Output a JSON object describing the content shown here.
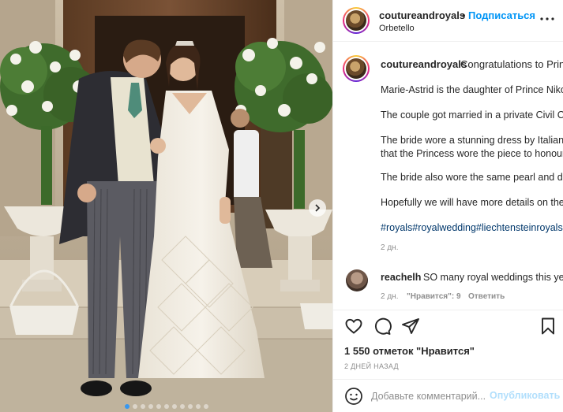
{
  "photo": {
    "alt_name": "wedding-photo",
    "slide_count": 11,
    "active_slide": 1
  },
  "header": {
    "username": "coutureandroyals",
    "separator": "•",
    "follow_label": "Подписаться",
    "location": "Orbetello",
    "more_icon": "more-horizontal-icon"
  },
  "caption": {
    "username": "coutureandroyals",
    "text": "Congratulations to Princ",
    "paragraphs": [
      "Marie-Astrid is the daughter of Prince Niko",
      "The couple got married in a private Civil Ce",
      "The bride wore a stunning dress by Italian c",
      "that the Princess wore the piece to honour",
      "The bride also wore the same pearl and dia",
      "Hopefully we will have more details on the"
    ],
    "hashtags": "#royals#royalwedding#liechtensteinroyals#",
    "age": "2 дн."
  },
  "comment": {
    "username": "reachelh",
    "text": "SO many royal weddings this yea",
    "age": "2 дн.",
    "likes": "\"Нравится\": 9",
    "reply": "Ответить"
  },
  "actions": {
    "like_icon": "heart-icon",
    "comment_icon": "comment-icon",
    "share_icon": "share-icon",
    "save_icon": "bookmark-icon"
  },
  "stats": {
    "likes": "1 550 отметок \"Нравится\"",
    "date": "2 ДНЕЙ НАЗАД"
  },
  "composer": {
    "placeholder": "Добавьте комментарий...",
    "publish_label": "Опубликовать",
    "emoji_icon": "emoji-icon"
  },
  "colors": {
    "accent": "#0095f6",
    "hashtag": "#00376b",
    "muted": "#8e8e8e",
    "publish_disabled": "#b2dffc"
  }
}
